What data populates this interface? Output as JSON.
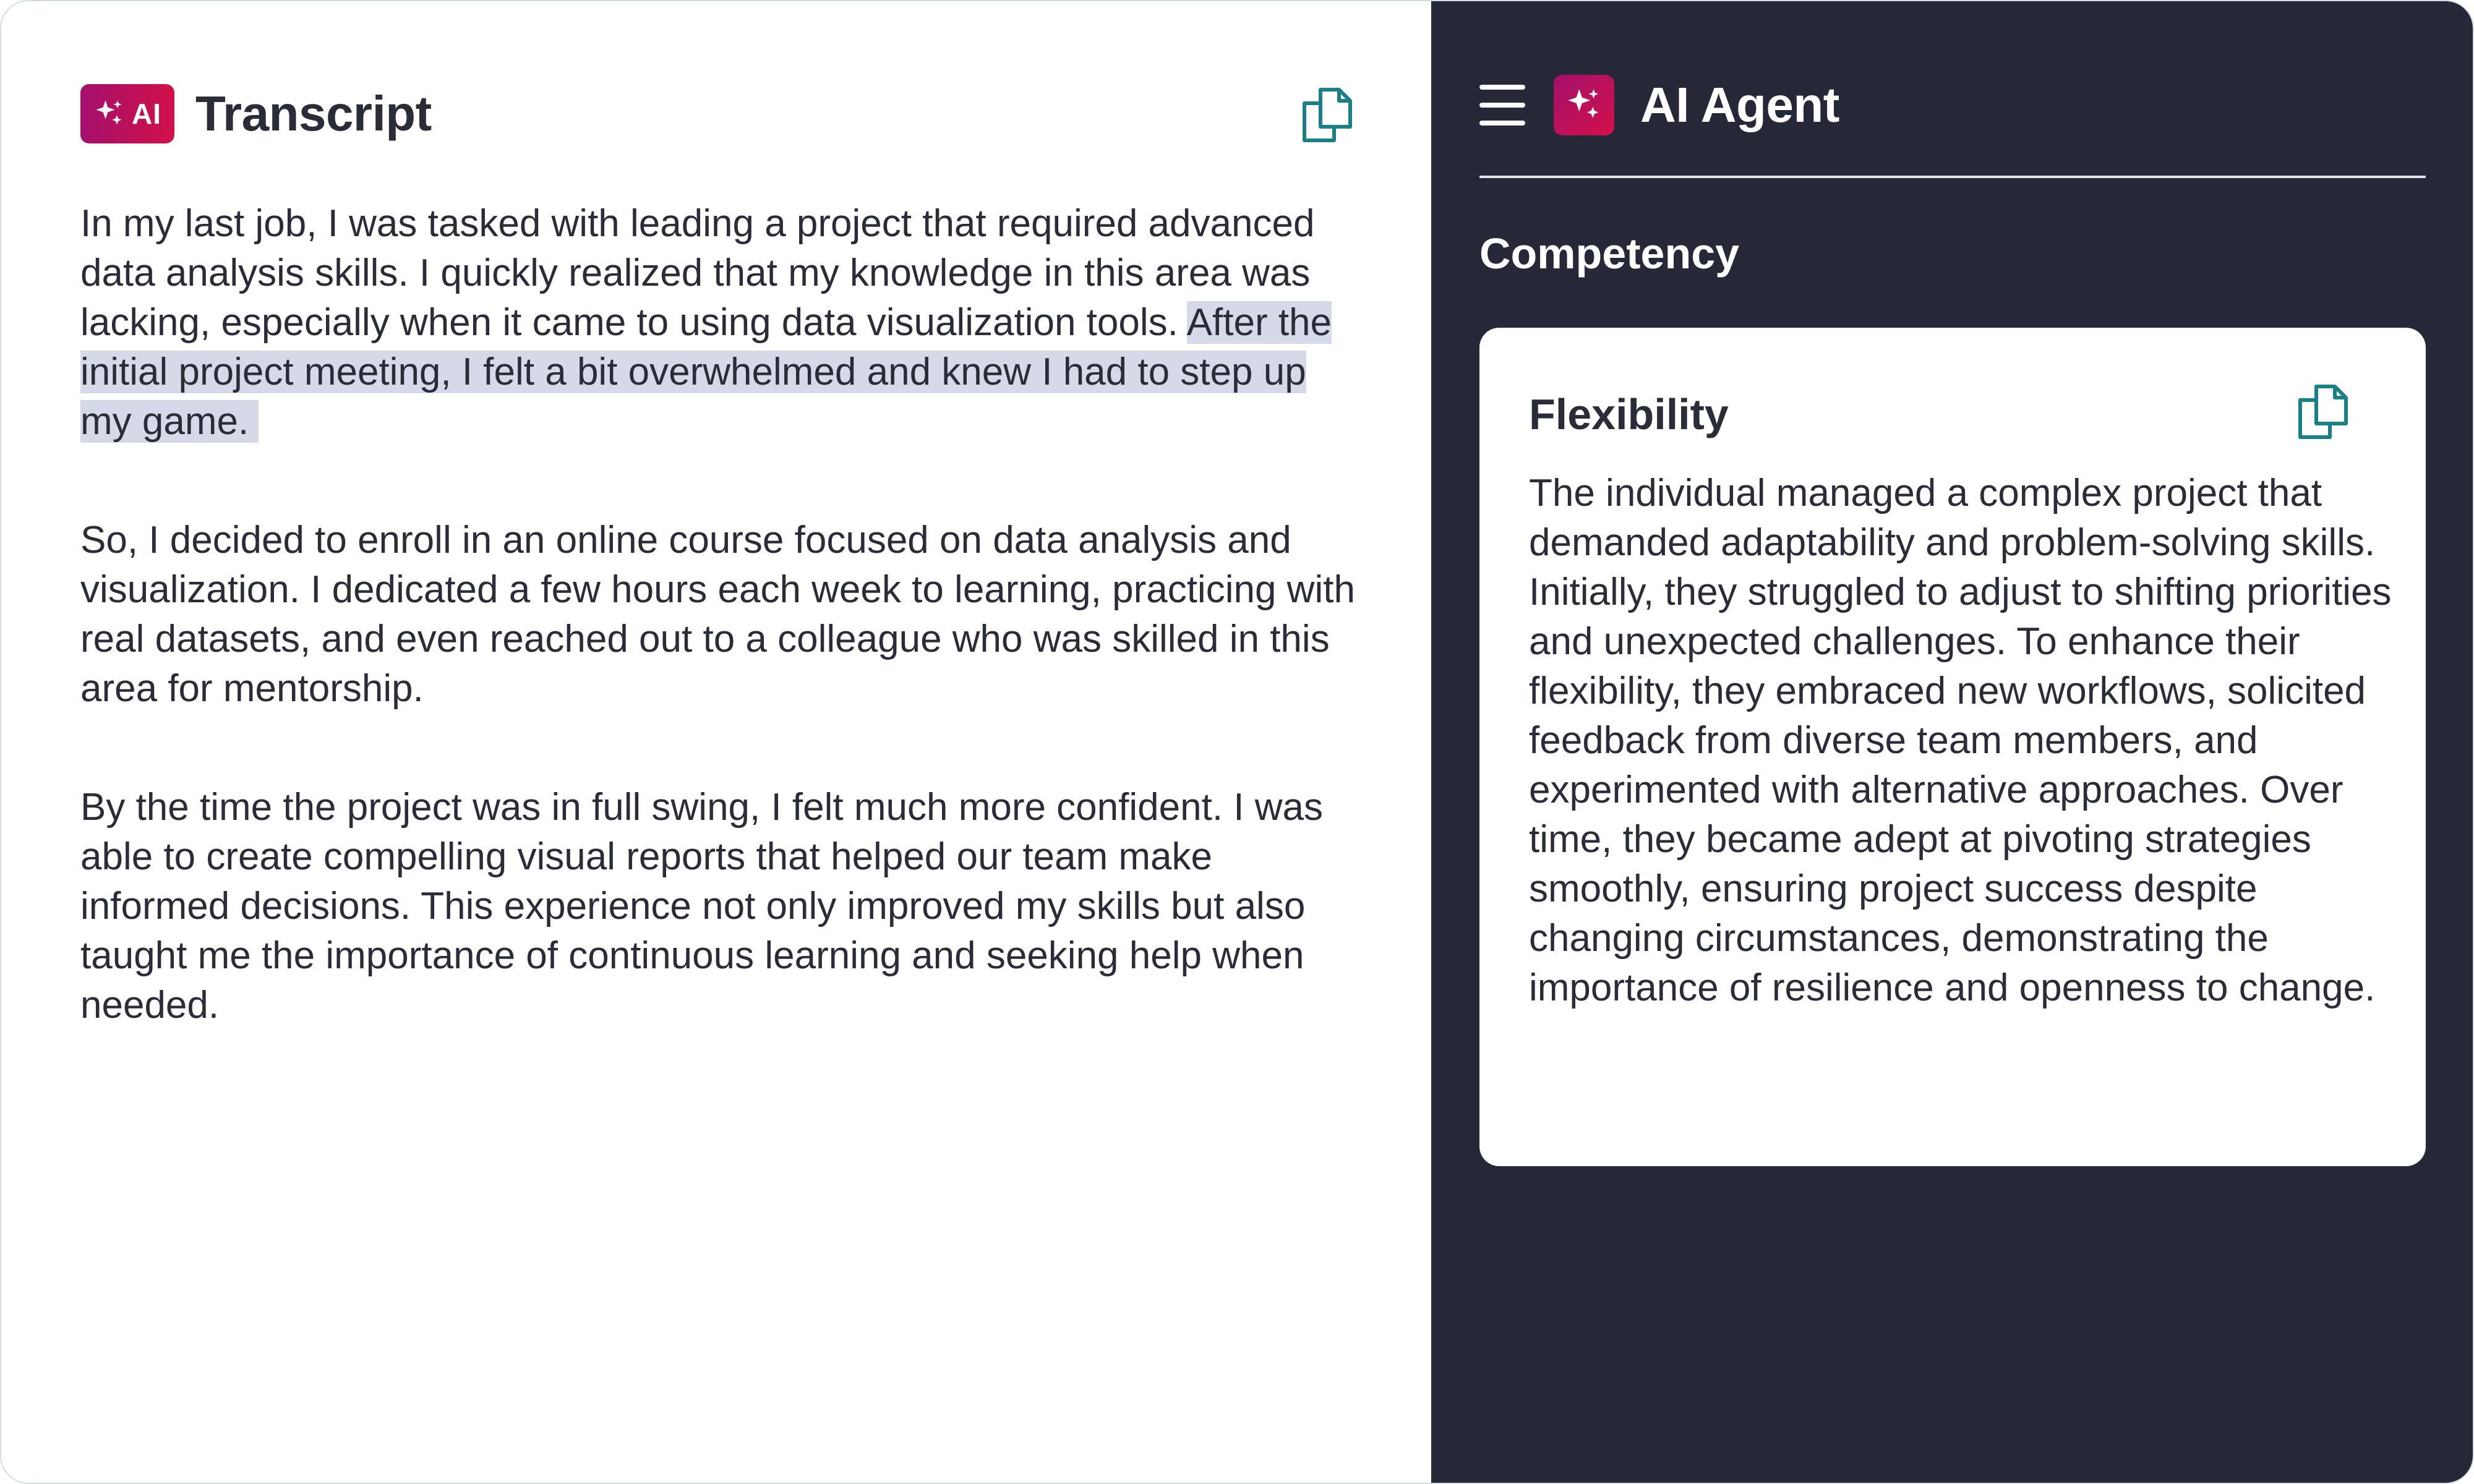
{
  "left_panel": {
    "badge_text": "AI",
    "title": "Transcript",
    "paragraphs": [
      {
        "text": "In my last job, I was tasked with leading a project that required advanced data analysis skills. I quickly realized that my knowledge in this area was lacking, especially when it came to using data visualization tools. ",
        "highlight": "After the initial project meeting, I felt a bit overwhelmed and knew I had to step up my game."
      },
      {
        "text": "So, I decided to enroll in an online course focused on data analysis and visualization. I dedicated a few hours each week to learning, practicing with real datasets, and even reached out to a colleague who was skilled in this area for mentorship."
      },
      {
        "text": "By the time the project was in full swing, I felt much more confident. I was able to create compelling visual reports that helped our team make informed decisions. This experience not only improved my skills but also taught me the importance of continuous learning and seeking help when needed."
      }
    ]
  },
  "right_panel": {
    "title": "AI Agent",
    "section_title": "Competency",
    "card": {
      "title": "Flexibility",
      "body": "The individual managed a complex project that demanded adaptability and problem-solving skills. Initially, they struggled to adjust to shifting priorities and unexpected challenges. To enhance their flexibility, they embraced new workflows, solicited feedback from diverse team members, and experimented with alternative approaches. Over time, they became adept at pivoting strategies smoothly, ensuring project success despite changing circumstances, demonstrating the importance of resilience and openness to change."
    }
  },
  "icons": {
    "badge_icon": "sparkles-icon",
    "menu_icon": "hamburger-menu-icon",
    "copy_icon": "copy-icon"
  },
  "colors": {
    "accent_gradient_start": "#a3106c",
    "accent_gradient_end": "#d3104a",
    "highlight": "#d6d9e8",
    "dark_panel": "#262837",
    "copy_icon": "#1a7f86",
    "text": "#2a2d38"
  }
}
